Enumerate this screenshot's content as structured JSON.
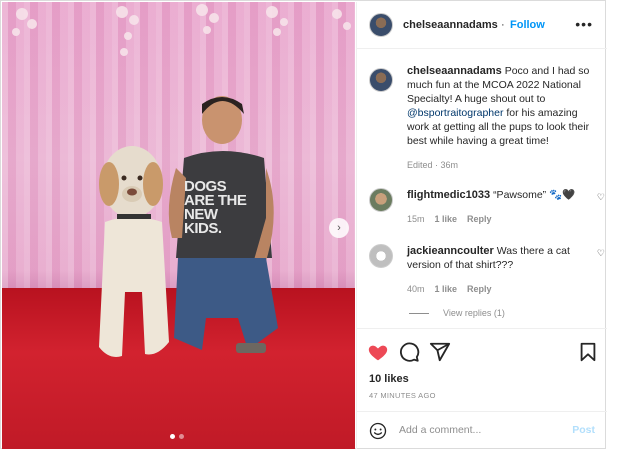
{
  "post": {
    "author": "chelseaannadams",
    "follow_label": "Follow",
    "more_label": "•••",
    "shirt_text": "DOGS ARE THE NEW KIDS.",
    "carousel": {
      "next_label": "›",
      "slide_count": 2,
      "current_slide": 1
    }
  },
  "caption": {
    "author": "chelseaannadams",
    "text_before": "Poco and I had so much fun at the MCOA 2022 National Specialty! A huge shout out to ",
    "mention": "@bsportraitographer",
    "text_after": " for his amazing work at getting all the pups to look their best while having a great time!",
    "meta": "Edited · 36m"
  },
  "comments": [
    {
      "author": "flightmedic1033",
      "text": "“Pawsome” 🐾🖤",
      "time": "15m",
      "likes": "1 like",
      "reply": "Reply"
    },
    {
      "author": "jackieanncoulter",
      "text": "Was there a cat version of that shirt???",
      "time": "40m",
      "likes": "1 like",
      "reply": "Reply"
    }
  ],
  "view_replies": "View replies (1)",
  "likes": "10 likes",
  "timestamp": "47 MINUTES AGO",
  "add_comment": {
    "placeholder": "Add a comment...",
    "post_label": "Post"
  },
  "colors": {
    "like_red": "#ed4956",
    "link_blue": "#0095f6",
    "mention_blue": "#00376b",
    "post_disabled": "#b2dffc"
  },
  "icons": [
    "heart-icon",
    "comment-icon",
    "share-icon",
    "bookmark-icon",
    "emoji-icon",
    "more-icon",
    "chevron-right-icon"
  ]
}
